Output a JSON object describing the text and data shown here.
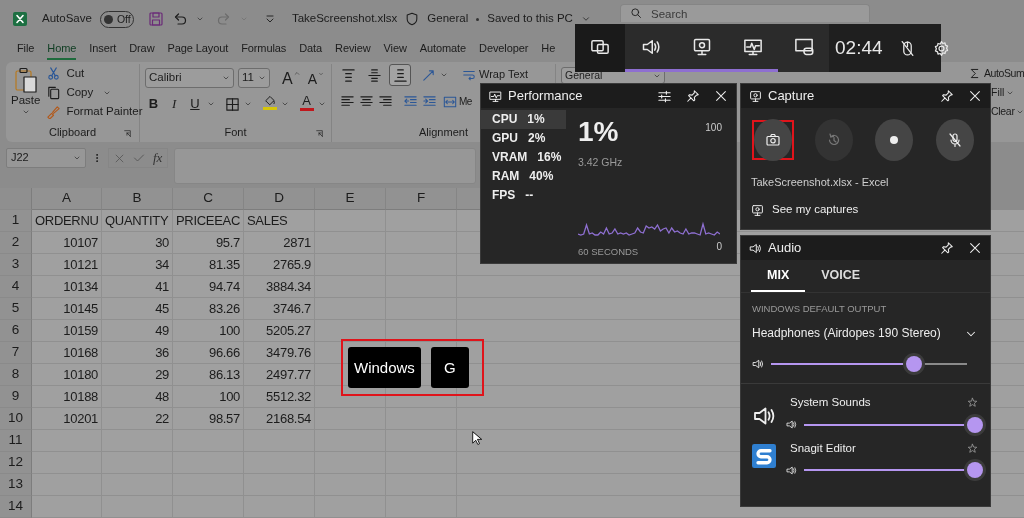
{
  "excel": {
    "title_bar": {
      "autosave": "AutoSave",
      "autosave_toggle": {
        "label": "Off",
        "on": false
      },
      "file_name": "TakeScreenshot.xlsx",
      "sensitivity": "General",
      "save_status": "Saved to this PC",
      "search": {
        "placeholder": "Search"
      }
    },
    "ribbon_tabs": [
      {
        "label": "File",
        "selected": false
      },
      {
        "label": "Home",
        "selected": true
      },
      {
        "label": "Insert",
        "selected": false
      },
      {
        "label": "Draw",
        "selected": false
      },
      {
        "label": "Page Layout",
        "selected": false
      },
      {
        "label": "Formulas",
        "selected": false
      },
      {
        "label": "Data",
        "selected": false
      },
      {
        "label": "Review",
        "selected": false
      },
      {
        "label": "View",
        "selected": false
      },
      {
        "label": "Automate",
        "selected": false
      },
      {
        "label": "Developer",
        "selected": false
      },
      {
        "label": "He",
        "selected": false
      }
    ],
    "clipboard": {
      "paste": "Paste",
      "cut": "Cut",
      "copy": "Copy",
      "format_painter": "Format Painter",
      "group_label": "Clipboard"
    },
    "font": {
      "font_name": "Calibri",
      "font_size": "11",
      "grow_font": "A",
      "shrink_font": "A",
      "bold": "B",
      "italic": "I",
      "underline": "U",
      "font_color": "A",
      "group_label": "Font"
    },
    "alignment": {
      "vertical_align": [
        {
          "kind": "top",
          "selected": false
        },
        {
          "kind": "middle",
          "selected": false
        },
        {
          "kind": "bottom",
          "selected": true
        }
      ],
      "wrap_text": "Wrap Text",
      "merge": "Me",
      "group_label": "Alignment"
    },
    "number": {
      "format": "General"
    },
    "editing": {
      "autosum": "AutoSum",
      "fill": "Fill",
      "clear": "Clear"
    },
    "formula_bar": {
      "name_box": "J22",
      "function_label": "fx"
    },
    "sheet": {
      "columns": [
        "A",
        "B",
        "C",
        "D",
        "E",
        "F"
      ],
      "rows": [
        {
          "number": "1",
          "kind": "header",
          "cells": [
            "ORDERNU",
            "QUANTITY",
            "PRICEEAC",
            "SALES"
          ]
        },
        {
          "number": "2",
          "kind": "data",
          "cells": [
            "10107",
            "30",
            "95.7",
            "2871"
          ]
        },
        {
          "number": "3",
          "kind": "data",
          "cells": [
            "10121",
            "34",
            "81.35",
            "2765.9"
          ]
        },
        {
          "number": "4",
          "kind": "data",
          "cells": [
            "10134",
            "41",
            "94.74",
            "3884.34"
          ]
        },
        {
          "number": "5",
          "kind": "data",
          "cells": [
            "10145",
            "45",
            "83.26",
            "3746.7"
          ]
        },
        {
          "number": "6",
          "kind": "data",
          "cells": [
            "10159",
            "49",
            "100",
            "5205.27"
          ]
        },
        {
          "number": "7",
          "kind": "data",
          "cells": [
            "10168",
            "36",
            "96.66",
            "3479.76"
          ]
        },
        {
          "number": "8",
          "kind": "data",
          "cells": [
            "10180",
            "29",
            "86.13",
            "2497.77"
          ]
        },
        {
          "number": "9",
          "kind": "data",
          "cells": [
            "10188",
            "48",
            "100",
            "5512.32"
          ]
        },
        {
          "number": "10",
          "kind": "data",
          "cells": [
            "10201",
            "22",
            "98.57",
            "2168.54"
          ]
        },
        {
          "number": "11"
        },
        {
          "number": "12"
        },
        {
          "number": "13"
        },
        {
          "number": "14"
        }
      ]
    },
    "key_hint": {
      "keys": [
        "Windows",
        "G"
      ],
      "highlighted": true
    }
  },
  "game_bar": {
    "widgets": [
      {
        "kind": "widget_menu",
        "selected": false
      },
      {
        "kind": "audio",
        "selected": true
      },
      {
        "kind": "capture",
        "selected": true
      },
      {
        "kind": "performance",
        "selected": true
      },
      {
        "kind": "xbox_social",
        "selected": false
      }
    ],
    "time": "02:44",
    "controls": [
      {
        "kind": "mouse_lock"
      },
      {
        "kind": "settings"
      }
    ]
  },
  "performance": {
    "title": "Performance",
    "metrics": [
      {
        "name": "CPU",
        "value": "1%",
        "selected": true
      },
      {
        "name": "GPU",
        "value": "2%",
        "selected": false
      },
      {
        "name": "VRAM",
        "value": "16%",
        "selected": false
      },
      {
        "name": "RAM",
        "value": "40%",
        "selected": false
      },
      {
        "name": "FPS",
        "value": "--",
        "selected": false
      }
    ],
    "big_value": "1%",
    "frequency": "3.42 GHz",
    "scale_max": "100",
    "scale_min": "0",
    "time_span": "60 SECONDS"
  },
  "capture": {
    "title": "Capture",
    "buttons": [
      {
        "kind": "screenshot",
        "disabled": false,
        "highlighted": true
      },
      {
        "kind": "record_last",
        "disabled": true,
        "highlighted": false
      },
      {
        "kind": "record",
        "disabled": false,
        "highlighted": false
      },
      {
        "kind": "microphone_off",
        "disabled": false,
        "highlighted": false
      }
    ],
    "target": "TakeScreenshot.xlsx - Excel",
    "captures_link": "See my captures"
  },
  "audio": {
    "title": "Audio",
    "tabs": [
      {
        "label": "MIX",
        "selected": true
      },
      {
        "label": "VOICE",
        "selected": false
      }
    ],
    "output_label": "WINDOWS DEFAULT OUTPUT",
    "output": {
      "device": "Headphones (Airdopes 190 Stereo)",
      "level": 0.69
    },
    "apps": [
      {
        "name": "System Sounds",
        "kind": "system",
        "level": 1.0
      },
      {
        "name": "Snagit Editor",
        "kind": "snagit",
        "level": 1.0
      }
    ]
  }
}
